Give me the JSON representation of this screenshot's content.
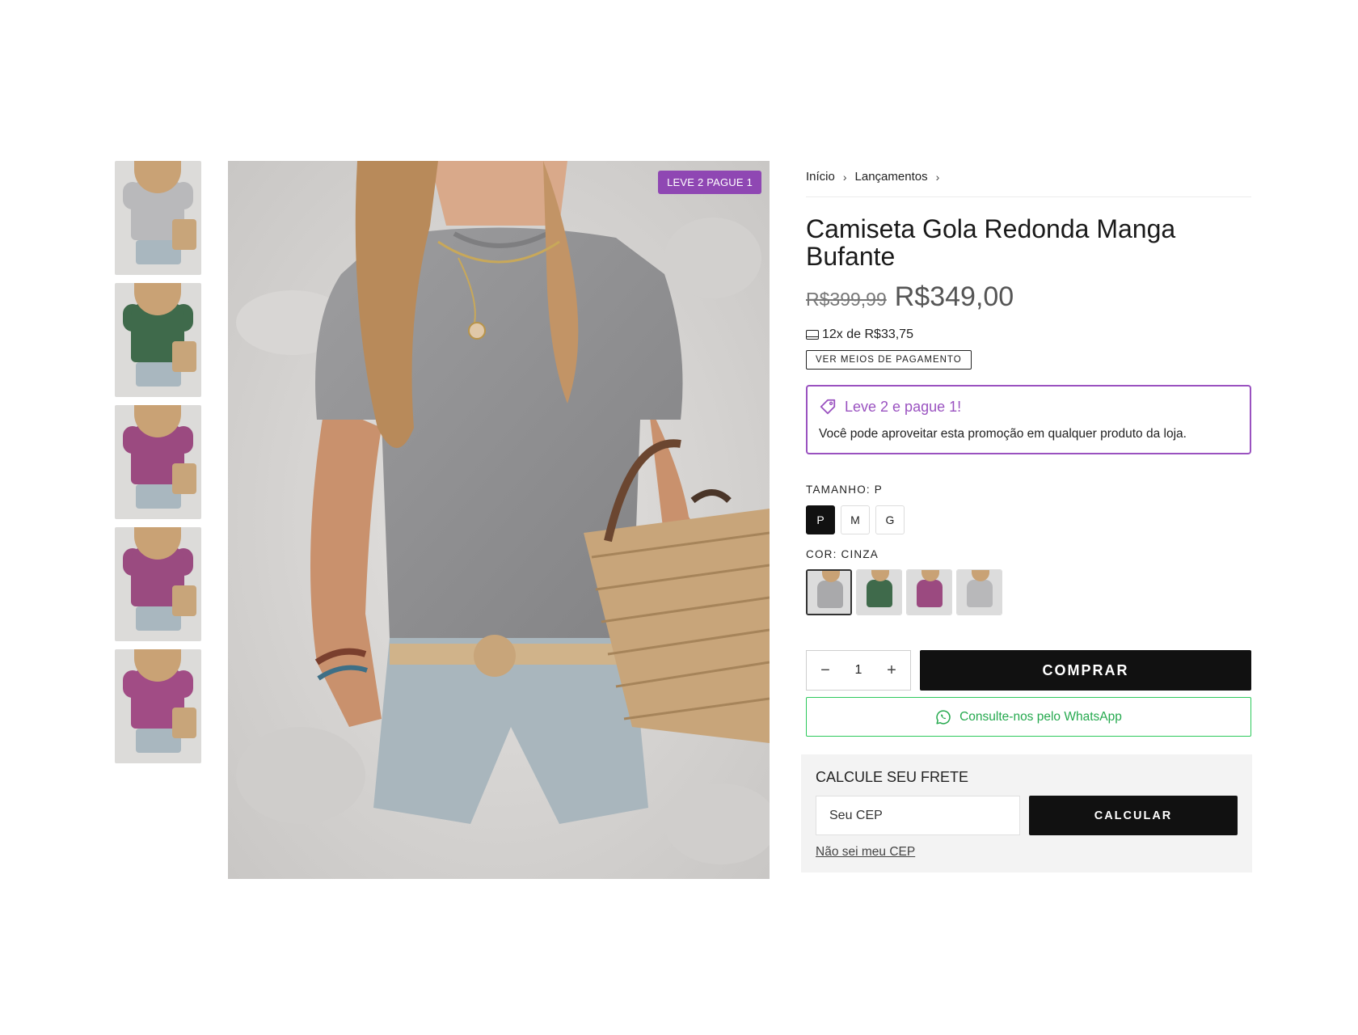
{
  "product": {
    "badge": "LEVE 2 PAGUE 1",
    "thumbnails": [
      {
        "color": "cinza",
        "shirt": "#b9b9bb"
      },
      {
        "color": "verde",
        "shirt": "#3f6a4b"
      },
      {
        "color": "roxo",
        "shirt": "#9b4a80"
      },
      {
        "color": "roxo-costas",
        "shirt": "#9a4b80"
      },
      {
        "color": "roxo-sentada",
        "shirt": "#a14c85"
      }
    ]
  },
  "breadcrumb": {
    "items": [
      "Início",
      "Lançamentos"
    ],
    "separator": "›"
  },
  "info": {
    "title": "Camiseta Gola Redonda Manga Bufante",
    "old_price": "R$399,99",
    "price": "R$349,00",
    "installments": "12x de R$33,75",
    "payment_button": "VER MEIOS DE PAGAMENTO"
  },
  "promo": {
    "title": "Leve 2 e pague 1!",
    "text": "Você pode aproveitar esta promoção em qualquer produto da loja.",
    "accent": "#9a52c0"
  },
  "size": {
    "label": "TAMANHO: P",
    "options": [
      "P",
      "M",
      "G"
    ],
    "selected": "P"
  },
  "color": {
    "label": "COR: CINZA",
    "swatches": [
      {
        "name": "cinza",
        "shirt": "#a9a9ab"
      },
      {
        "name": "verde",
        "shirt": "#3f6a4b"
      },
      {
        "name": "roxo",
        "shirt": "#9b4a80"
      },
      {
        "name": "cinza-claro",
        "shirt": "#b8b8ba"
      }
    ]
  },
  "purchase": {
    "quantity": "1",
    "minus": "−",
    "plus": "+",
    "buy_label": "COMPRAR",
    "whatsapp_label": "Consulte-nos pelo WhatsApp",
    "whatsapp_color": "#2dc95c"
  },
  "shipping": {
    "title": "CALCULE SEU FRETE",
    "cep_placeholder": "Seu CEP",
    "calc_label": "CALCULAR",
    "no_cep_link": "Não sei meu CEP"
  }
}
